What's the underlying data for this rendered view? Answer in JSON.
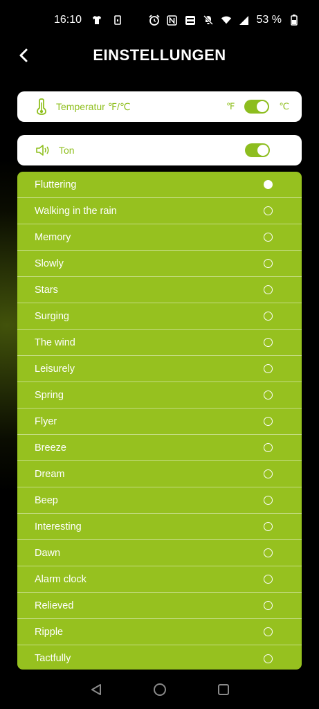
{
  "status_bar": {
    "time": "16:10",
    "battery_text": "53 %"
  },
  "header": {
    "title": "EINSTELLUNGEN"
  },
  "temperature": {
    "label": "Temperatur ℉/℃",
    "unit_left": "℉",
    "unit_right": "℃",
    "toggle_on": true
  },
  "sound": {
    "label": "Ton",
    "toggle_on": true
  },
  "sounds": [
    {
      "label": "Fluttering",
      "selected": true
    },
    {
      "label": "Walking in the rain",
      "selected": false
    },
    {
      "label": "Memory",
      "selected": false
    },
    {
      "label": "Slowly",
      "selected": false
    },
    {
      "label": "Stars",
      "selected": false
    },
    {
      "label": "Surging",
      "selected": false
    },
    {
      "label": "The wind",
      "selected": false
    },
    {
      "label": "Leisurely",
      "selected": false
    },
    {
      "label": "Spring",
      "selected": false
    },
    {
      "label": "Flyer",
      "selected": false
    },
    {
      "label": "Breeze",
      "selected": false
    },
    {
      "label": "Dream",
      "selected": false
    },
    {
      "label": "Beep",
      "selected": false
    },
    {
      "label": "Interesting",
      "selected": false
    },
    {
      "label": "Dawn",
      "selected": false
    },
    {
      "label": "Alarm clock",
      "selected": false
    },
    {
      "label": "Relieved",
      "selected": false
    },
    {
      "label": "Ripple",
      "selected": false
    },
    {
      "label": "Tactfully",
      "selected": false
    }
  ],
  "colors": {
    "accent": "#96c11f",
    "background": "#000000",
    "card": "#ffffff"
  }
}
